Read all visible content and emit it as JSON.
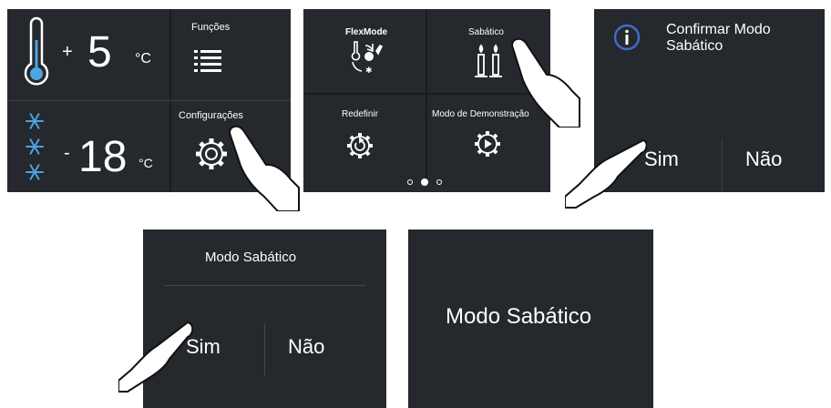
{
  "panel1": {
    "fridge": {
      "sign": "+",
      "value": "5",
      "unit": "°C"
    },
    "freezer": {
      "sign": "-",
      "value": "18",
      "unit": "°C"
    },
    "functions_label": "Funções",
    "settings_label": "Configurações"
  },
  "panel2": {
    "flexmode_label": "FlexMode",
    "sabbath_label": "Sabático",
    "reset_label": "Redefinir",
    "demo_label": "Modo de Demonstração",
    "pages": {
      "count": 3,
      "active": 1
    }
  },
  "panel3": {
    "title": "Confirmar Modo Sabático",
    "yes_label": "Sim",
    "no_label": "Não"
  },
  "panel4": {
    "title": "Modo Sabático",
    "yes_label": "Sim",
    "no_label": "Não"
  },
  "panel5": {
    "message": "Modo Sabático"
  },
  "icons": {
    "thermometer": "thermometer-icon",
    "snowflake": "snowflake-icon",
    "functions": "list-icon",
    "settings": "gear-icon",
    "flexmode": "flexmode-icon",
    "sabbath": "candles-icon",
    "reset": "reset-gear-icon",
    "demo": "play-gear-icon",
    "info": "info-icon",
    "hand": "pointing-hand-icon"
  },
  "colors": {
    "panel_bg": "#25282c",
    "text": "#ffffff",
    "info_ring": "#3e6cc8",
    "thermo_liquid": "#4ea3e0",
    "snowflake": "#4ea3e0"
  }
}
